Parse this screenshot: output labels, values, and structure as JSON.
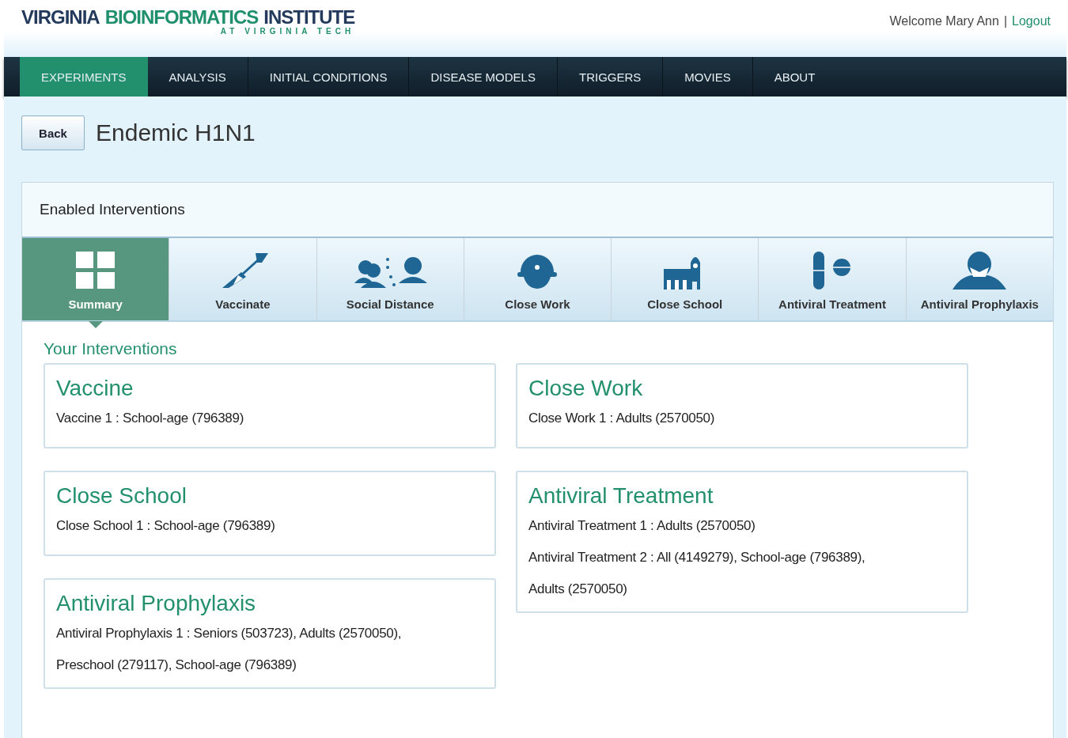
{
  "logo": {
    "parts": [
      {
        "text": "VIRGINIA",
        "color": "#233a5c"
      },
      {
        "text": "BIOINFORMATICS",
        "color": "#1f8f6c"
      },
      {
        "text": "INSTITUTE",
        "color": "#233a5c"
      }
    ],
    "tagline": "AT VIRGINIA TECH"
  },
  "user": {
    "welcome": "Welcome Mary Ann",
    "separator": "|",
    "logout": "Logout"
  },
  "nav": [
    {
      "label": "EXPERIMENTS",
      "selected": true
    },
    {
      "label": "ANALYSIS",
      "selected": false
    },
    {
      "label": "INITIAL CONDITIONS",
      "selected": false
    },
    {
      "label": "DISEASE MODELS",
      "selected": false
    },
    {
      "label": "TRIGGERS",
      "selected": false
    },
    {
      "label": "MOVIES",
      "selected": false
    },
    {
      "label": "ABOUT",
      "selected": false
    }
  ],
  "back_button": "Back",
  "page_title": "Endemic H1N1",
  "panel": {
    "title": "Enabled Interventions",
    "tabs": [
      {
        "label": "Summary",
        "kind": "summary",
        "selected": true
      },
      {
        "label": "Vaccinate",
        "kind": "vaccinate",
        "selected": false
      },
      {
        "label": "Social Distance",
        "kind": "distance",
        "selected": false
      },
      {
        "label": "Close Work",
        "kind": "work",
        "selected": false
      },
      {
        "label": "Close School",
        "kind": "school",
        "selected": false
      },
      {
        "label": "Antiviral Treatment",
        "kind": "pill",
        "selected": false
      },
      {
        "label": "Antiviral Prophylaxis",
        "kind": "mask",
        "selected": false
      }
    ],
    "section_title": "Your Interventions",
    "columns": [
      [
        {
          "title": "Vaccine",
          "lines": [
            "Vaccine 1 : School-age (796389)"
          ]
        },
        {
          "title": "Close School",
          "lines": [
            "Close School 1 : School-age (796389)"
          ]
        },
        {
          "title": "Antiviral Prophylaxis",
          "lines": [
            "Antiviral Prophylaxis 1 : Seniors (503723), Adults (2570050), Preschool (279117), School-age (796389)"
          ]
        }
      ],
      [
        {
          "title": "Close Work",
          "lines": [
            "Close Work 1 : Adults (2570050)"
          ]
        },
        {
          "title": "Antiviral Treatment",
          "lines": [
            "Antiviral Treatment 1 : Adults (2570050)",
            "Antiviral Treatment 2 : All (4149279), School-age (796389), Adults (2570050)"
          ]
        }
      ]
    ]
  }
}
